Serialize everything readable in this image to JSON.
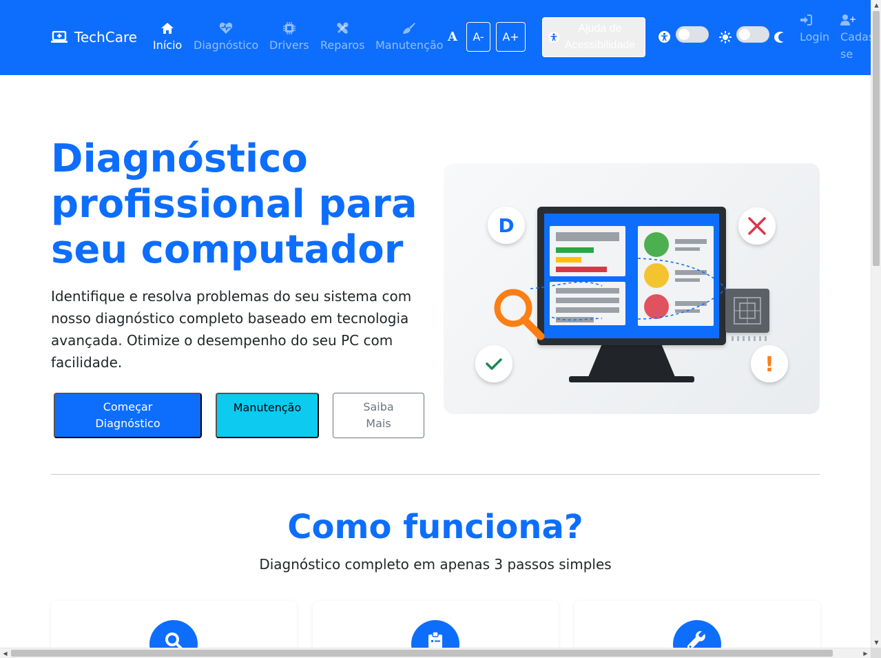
{
  "brand": {
    "name": "TechCare",
    "icon": "laptop-medical-icon"
  },
  "nav": {
    "items": [
      {
        "label": "Início",
        "icon": "home-icon",
        "active": true
      },
      {
        "label": "Diagnóstico",
        "icon": "heartbeat-icon",
        "active": false
      },
      {
        "label": "Drivers",
        "icon": "microchip-icon",
        "active": false
      },
      {
        "label": "Reparos",
        "icon": "tools-icon",
        "active": false
      },
      {
        "label": "Manutenção",
        "icon": "broom-icon",
        "active": false
      }
    ],
    "font_decrease": "A-",
    "font_increase": "A+",
    "accessibility_help_line1": "Ajuda de",
    "accessibility_help_line2": "Acessibilidade",
    "login": "Login",
    "signup_line1": "Cadas",
    "signup_line2": "se"
  },
  "hero": {
    "title_line1": "Diagnóstico",
    "title_line2": "profissional para",
    "title_line3": "seu computador",
    "description": "Identifique e resolva problemas do seu sistema com nosso diagnóstico completo baseado em tecnologia avançada. Otimize o desempenho do seu PC com facilidade.",
    "btn_start_line1": "Começar",
    "btn_start_line2": "Diagnóstico",
    "btn_maintenance": "Manutenção",
    "btn_more_line1": "Saiba",
    "btn_more_line2": "Mais",
    "illus_badge_letter": "D",
    "illus_badge_alert": "!"
  },
  "how": {
    "title": "Como funciona?",
    "subtitle": "Diagnóstico completo em apenas 3 passos simples",
    "cards": [
      {
        "icon": "search-icon"
      },
      {
        "icon": "clipboard-icon"
      },
      {
        "icon": "wrench-icon"
      }
    ]
  },
  "colors": {
    "primary": "#0d6efd",
    "info": "#0dcaf0",
    "secondary": "#6c757d",
    "success": "#4caf50",
    "warning": "#f4c430",
    "danger": "#dc3545",
    "orange": "#fd7e14"
  }
}
